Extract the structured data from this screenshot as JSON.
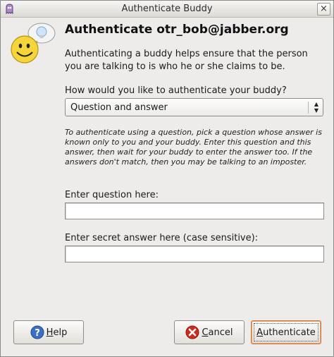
{
  "window": {
    "title": "Authenticate Buddy",
    "close_label": "×"
  },
  "heading": "Authenticate otr_bob@jabber.org",
  "intro": "Authenticating a buddy helps ensure that the person you are talking to is who he or she claims to be.",
  "method": {
    "label": "How would you like to authenticate your buddy?",
    "selected": "Question and answer"
  },
  "hint": "To authenticate using a question, pick a question whose answer is known only to you and your buddy.  Enter this question and this answer, then wait for your buddy to enter the answer too.  If the answers don't match, then you may be talking to an imposter.",
  "question": {
    "label": "Enter question here:",
    "value": ""
  },
  "answer": {
    "label": "Enter secret answer here (case sensitive):",
    "value": ""
  },
  "buttons": {
    "help_mnemonic": "H",
    "help_rest": "elp",
    "cancel_mnemonic": "C",
    "cancel_rest": "ancel",
    "auth_mnemonic": "A",
    "auth_rest": "uthenticate"
  },
  "colors": {
    "focus_border": "#d07a3c",
    "background": "#edeceb"
  }
}
